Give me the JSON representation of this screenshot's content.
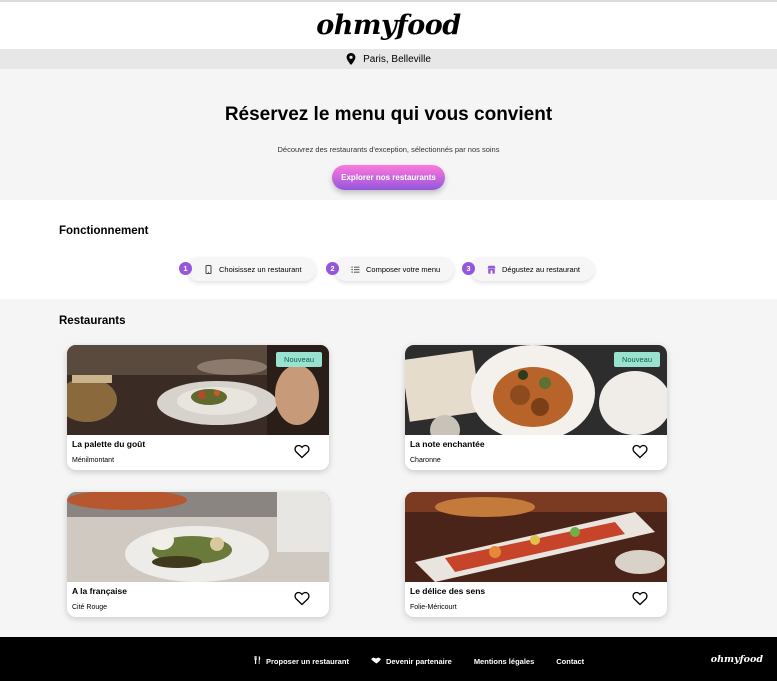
{
  "header": {
    "logo": "ohmyfood"
  },
  "location": {
    "icon": "map-pin-icon",
    "label": "Paris, Belleville"
  },
  "hero": {
    "title": "Réservez le menu qui vous convient",
    "subtitle": "Découvrez des restaurants d'exception, sélectionnés par nos soins",
    "button_label": "Explorer nos restaurants"
  },
  "how": {
    "title": "Fonctionnement",
    "steps": [
      {
        "number": "1",
        "icon": "smartphone-icon",
        "label": "Choisissez un restaurant"
      },
      {
        "number": "2",
        "icon": "list-icon",
        "label": "Composer votre menu"
      },
      {
        "number": "3",
        "icon": "store-icon",
        "label": "Dégustez au restaurant"
      }
    ]
  },
  "restaurants": {
    "title": "Restaurants",
    "items": [
      {
        "name": "La palette du goût",
        "location": "Ménilmontant",
        "badge": "Nouveau"
      },
      {
        "name": "La note enchantée",
        "location": "Charonne",
        "badge": "Nouveau"
      },
      {
        "name": "A la française",
        "location": "Cité Rouge",
        "badge": ""
      },
      {
        "name": "Le délice des sens",
        "location": "Folie-Méricourt",
        "badge": ""
      }
    ]
  },
  "footer": {
    "links": [
      {
        "icon": "utensils-icon",
        "label": "Proposer un restaurant"
      },
      {
        "icon": "handshake-icon",
        "label": "Devenir partenaire"
      },
      {
        "icon": "",
        "label": "Mentions légales"
      },
      {
        "icon": "",
        "label": "Contact"
      }
    ],
    "logo": "ohmyfood"
  },
  "colors": {
    "accent_start": "#ff79da",
    "accent_end": "#9356dc",
    "badge_bg": "#99e2d0",
    "badge_text": "#0f5e4d"
  }
}
